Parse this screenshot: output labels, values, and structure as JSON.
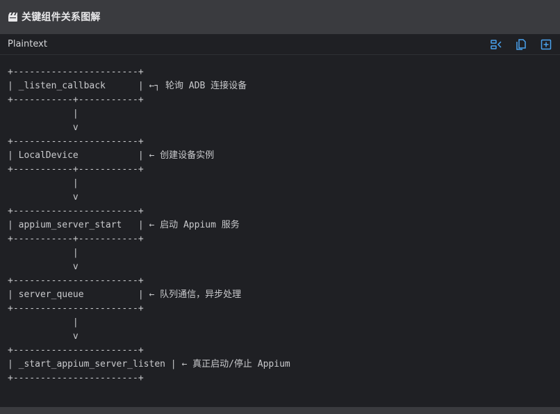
{
  "header": {
    "icon": "clapper-board-icon",
    "title": "关键组件关系图解"
  },
  "code_block": {
    "language": "Plaintext",
    "toolbar": [
      {
        "name": "wrap-toggle-icon"
      },
      {
        "name": "copy-icon"
      },
      {
        "name": "expand-icon"
      }
    ],
    "lines": [
      "+-----------------------+",
      "| _listen_callback      | ←┐ 轮询 ADB 连接设备",
      "+-----------+-----------+",
      "            |",
      "            v",
      "+-----------------------+",
      "| LocalDevice           | ← 创建设备实例",
      "+-----------+-----------+",
      "            |",
      "            v",
      "+-----------------------+",
      "| appium_server_start   | ← 启动 Appium 服务",
      "+-----------+-----------+",
      "            |",
      "            v",
      "+-----------------------+",
      "| server_queue          | ← 队列通信，异步处理",
      "+-----------------------+",
      "            |",
      "            v",
      "+-----------------------+",
      "| _start_appium_server_listen | ← 真正启动/停止 Appium",
      "+-----------------------+"
    ]
  },
  "colors": {
    "header_bg": "#3a3b3f",
    "panel_bg": "#1f2024",
    "accent": "#4aa3f0",
    "code_text": "#c9cacd"
  }
}
